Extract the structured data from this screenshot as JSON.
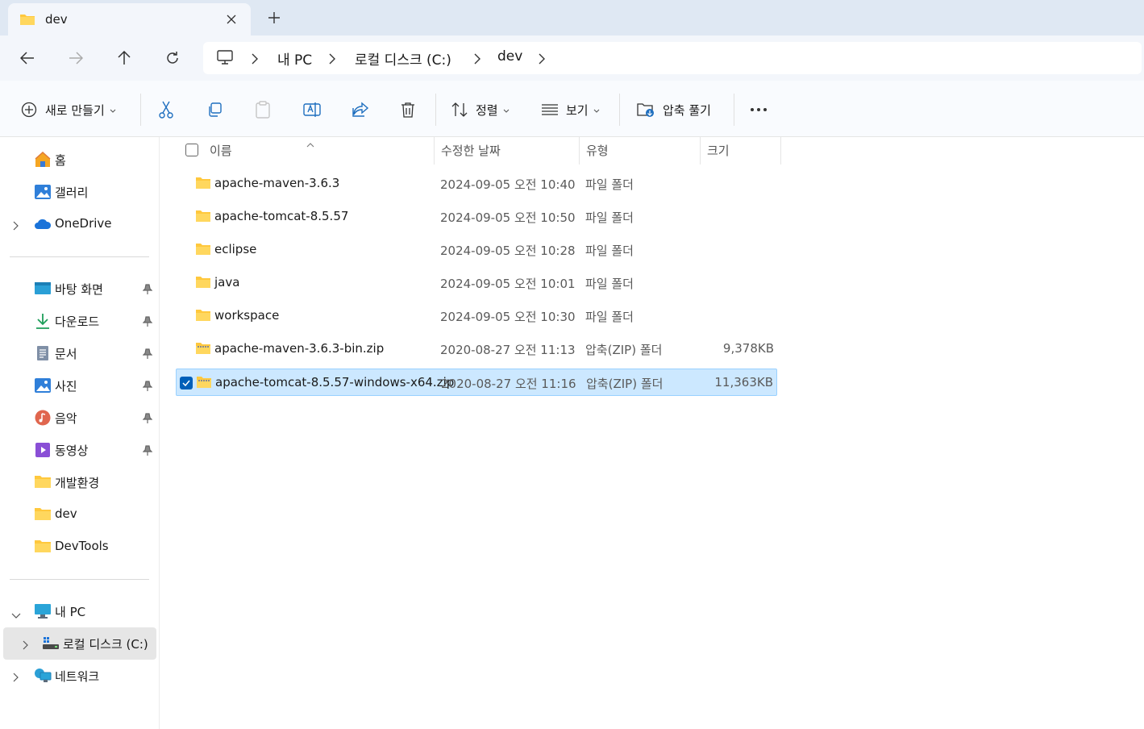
{
  "tab": {
    "title": "dev"
  },
  "breadcrumb": [
    "내 PC",
    "로컬 디스크 (C:)",
    "dev"
  ],
  "toolbar": {
    "new_label": "새로 만들기",
    "sort_label": "정렬",
    "view_label": "보기",
    "extract_label": "압축 풀기",
    "more_label": "···"
  },
  "sidebar": {
    "top": [
      {
        "label": "홈",
        "icon": "home-icon"
      },
      {
        "label": "갤러리",
        "icon": "gallery-icon"
      },
      {
        "label": "OneDrive",
        "icon": "cloud-icon"
      }
    ],
    "pinned": [
      {
        "label": "바탕 화면",
        "icon": "desktop-icon"
      },
      {
        "label": "다운로드",
        "icon": "download-icon"
      },
      {
        "label": "문서",
        "icon": "document-icon"
      },
      {
        "label": "사진",
        "icon": "pictures-icon"
      },
      {
        "label": "음악",
        "icon": "music-icon"
      },
      {
        "label": "동영상",
        "icon": "video-icon"
      },
      {
        "label": "개발환경",
        "icon": "folder-icon"
      },
      {
        "label": "dev",
        "icon": "folder-icon"
      },
      {
        "label": "DevTools",
        "icon": "folder-icon"
      }
    ],
    "bottom": [
      {
        "label": "내 PC",
        "icon": "pc-icon"
      },
      {
        "label": "로컬 디스크 (C:)",
        "icon": "drive-icon"
      },
      {
        "label": "네트워크",
        "icon": "network-icon"
      }
    ]
  },
  "columns": {
    "name": "이름",
    "modified": "수정한 날짜",
    "type": "유형",
    "size": "크기"
  },
  "files": [
    {
      "name": "apache-maven-3.6.3",
      "date": "2024-09-05 오전 10:40",
      "type": "파일 폴더",
      "size": "",
      "kind": "folder"
    },
    {
      "name": "apache-tomcat-8.5.57",
      "date": "2024-09-05 오전 10:50",
      "type": "파일 폴더",
      "size": "",
      "kind": "folder"
    },
    {
      "name": "eclipse",
      "date": "2024-09-05 오전 10:28",
      "type": "파일 폴더",
      "size": "",
      "kind": "folder"
    },
    {
      "name": "java",
      "date": "2024-09-05 오전 10:01",
      "type": "파일 폴더",
      "size": "",
      "kind": "folder"
    },
    {
      "name": "workspace",
      "date": "2024-09-05 오전 10:30",
      "type": "파일 폴더",
      "size": "",
      "kind": "folder"
    },
    {
      "name": "apache-maven-3.6.3-bin.zip",
      "date": "2020-08-27 오전 11:13",
      "type": "압축(ZIP) 폴더",
      "size": "9,378KB",
      "kind": "zip"
    },
    {
      "name": "apache-tomcat-8.5.57-windows-x64.zip",
      "date": "2020-08-27 오전 11:16",
      "type": "압축(ZIP) 폴더",
      "size": "11,363KB",
      "kind": "zip",
      "selected": true
    }
  ],
  "colors": {
    "selected_row": "#cce8ff",
    "accent": "#005fb8",
    "folder": "#ffc83d"
  }
}
